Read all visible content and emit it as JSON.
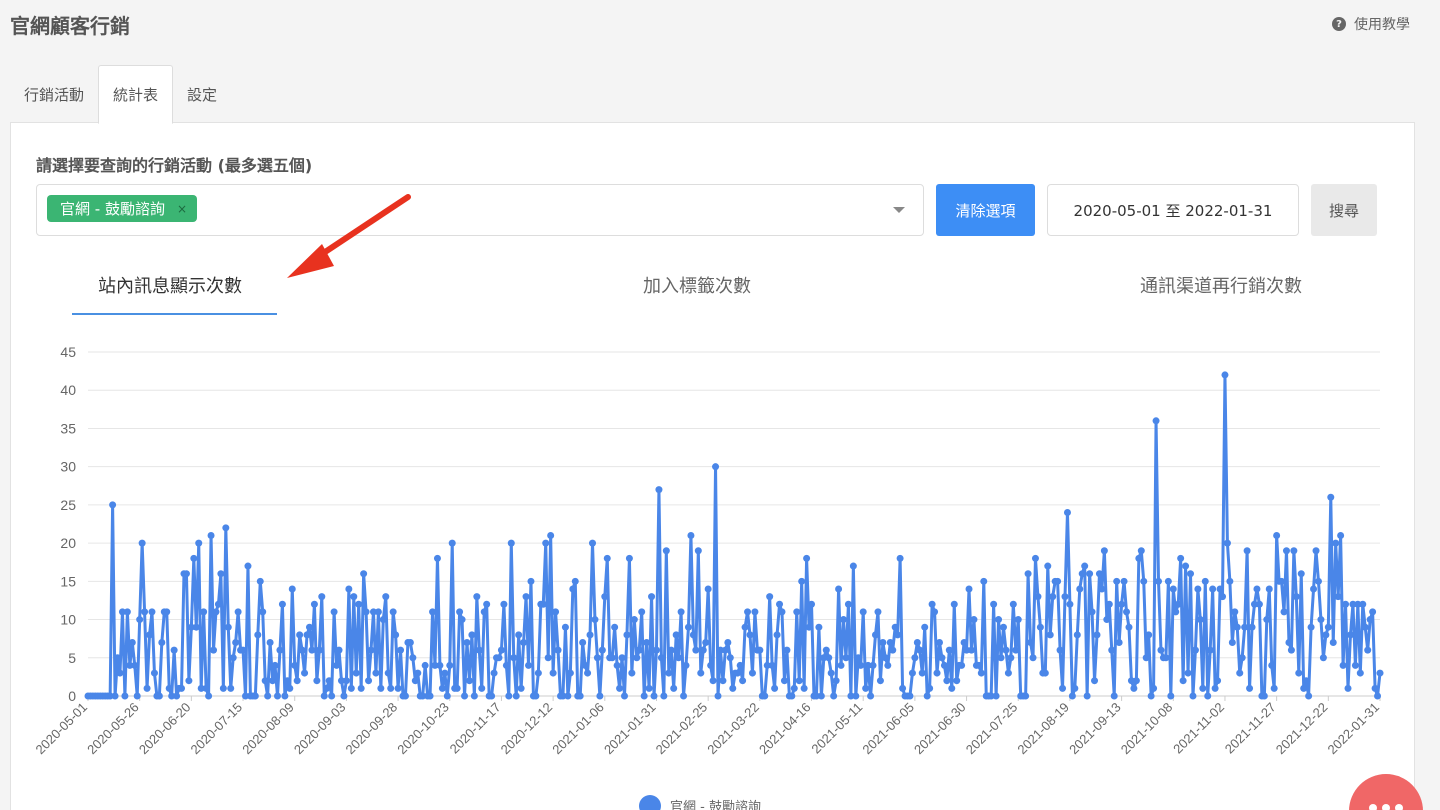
{
  "header": {
    "title": "官網顧客行銷",
    "help_label": "使用教學",
    "help_icon": "question-circle-icon"
  },
  "tabs": [
    {
      "label": "行銷活動"
    },
    {
      "label": "統計表"
    },
    {
      "label": "設定"
    }
  ],
  "filter": {
    "label": "請選擇要查詢的行銷活動 (最多選五個)",
    "selected_chip": "官網 - 鼓勵諮詢",
    "chip_remove": "×",
    "clear_button": "清除選項",
    "date_range": "2020-05-01 至 2022-01-31",
    "search_button": "搜尋"
  },
  "chart_tabs": [
    {
      "label": "站內訊息顯示次數"
    },
    {
      "label": "加入標籤次數"
    },
    {
      "label": "通訊渠道再行銷次數"
    }
  ],
  "colors": {
    "line": "#4a86e8",
    "clear_button": "#3d8ef5",
    "chip": "#3bb573",
    "arrow": "#e8321f",
    "fab": "#f06767"
  },
  "chart_data": {
    "type": "line",
    "series": [
      {
        "name": "官網 - 鼓勵諮詢",
        "values": [
          0,
          0,
          0,
          0,
          0,
          0,
          0,
          0,
          0,
          0,
          25,
          0,
          5,
          3,
          11,
          0,
          11,
          4,
          7,
          4,
          0,
          10,
          20,
          11,
          1,
          8,
          11,
          3,
          0,
          0,
          7,
          11,
          11,
          1,
          0,
          6,
          0,
          1,
          1,
          16,
          16,
          2,
          9,
          18,
          9,
          20,
          1,
          11,
          1,
          0,
          21,
          6,
          11,
          12,
          16,
          1,
          22,
          9,
          1,
          5,
          7,
          11,
          6,
          6,
          0,
          17,
          0,
          0,
          0,
          8,
          15,
          11,
          2,
          0,
          7,
          2,
          4,
          0,
          6,
          12,
          0,
          2,
          1,
          14,
          4,
          2,
          8,
          6,
          3,
          8,
          9,
          6,
          12,
          2,
          6,
          13,
          0,
          1,
          2,
          0,
          11,
          4,
          6,
          2,
          0,
          2,
          14,
          1,
          13,
          3,
          12,
          1,
          16,
          11,
          2,
          6,
          11,
          3,
          11,
          1,
          10,
          13,
          3,
          1,
          11,
          8,
          1,
          6,
          0,
          0,
          7,
          7,
          5,
          2,
          3,
          0,
          0,
          4,
          0,
          0,
          11,
          4,
          18,
          4,
          1,
          3,
          0,
          4,
          20,
          1,
          1,
          11,
          10,
          0,
          7,
          2,
          8,
          0,
          13,
          6,
          1,
          11,
          12,
          0,
          0,
          3,
          5,
          5,
          6,
          12,
          4,
          0,
          20,
          5,
          0,
          8,
          1,
          7,
          13,
          4,
          15,
          0,
          0,
          3,
          12,
          12,
          20,
          5,
          21,
          3,
          11,
          6,
          0,
          0,
          9,
          0,
          3,
          14,
          15,
          0,
          0,
          7,
          4,
          3,
          8,
          20,
          10,
          5,
          0,
          6,
          13,
          18,
          5,
          5,
          9,
          4,
          1,
          5,
          0,
          8,
          18,
          3,
          10,
          5,
          6,
          11,
          0,
          7,
          1,
          13,
          0,
          6,
          27,
          5,
          0,
          19,
          3,
          6,
          1,
          8,
          5,
          11,
          0,
          4,
          9,
          21,
          8,
          6,
          19,
          3,
          6,
          7,
          14,
          4,
          2,
          30,
          0,
          6,
          2,
          6,
          7,
          5,
          1,
          3,
          3,
          4,
          2,
          9,
          11,
          8,
          3,
          11,
          6,
          6,
          0,
          0,
          4,
          13,
          4,
          1,
          8,
          12,
          11,
          2,
          6,
          0,
          0,
          1,
          11,
          2,
          15,
          1,
          18,
          9,
          12,
          0,
          0,
          9,
          0,
          5,
          6,
          5,
          3,
          0,
          2,
          14,
          4,
          10,
          5,
          12,
          0,
          17,
          0,
          5,
          4,
          11,
          1,
          4,
          0,
          4,
          8,
          11,
          2,
          7,
          5,
          4,
          7,
          6,
          9,
          8,
          18,
          1,
          0,
          0,
          0,
          3,
          5,
          7,
          6,
          3,
          9,
          0,
          1,
          12,
          11,
          3,
          7,
          5,
          4,
          2,
          6,
          1,
          12,
          2,
          4,
          4,
          7,
          6,
          14,
          6,
          10,
          4,
          4,
          3,
          15,
          0,
          0,
          0,
          12,
          0,
          10,
          5,
          9,
          6,
          3,
          5,
          12,
          6,
          10,
          0,
          0,
          0,
          16,
          7,
          5,
          18,
          13,
          9,
          3,
          3,
          17,
          8,
          13,
          15,
          15,
          6,
          1,
          13,
          24,
          12,
          0,
          1,
          8,
          14,
          16,
          17,
          0,
          16,
          11,
          2,
          8,
          16,
          14,
          19,
          10,
          12,
          6,
          0,
          15,
          7,
          12,
          15,
          11,
          9,
          2,
          1,
          2,
          18,
          19,
          15,
          5,
          8,
          0,
          1,
          36,
          15,
          6,
          5,
          5,
          15,
          0,
          14,
          11,
          12,
          18,
          2,
          17,
          3,
          16,
          0,
          6,
          14,
          10,
          1,
          15,
          0,
          6,
          14,
          1,
          2,
          14,
          13,
          42,
          20,
          15,
          7,
          11,
          9,
          3,
          5,
          9,
          19,
          1,
          9,
          12,
          14,
          12,
          0,
          0,
          10,
          14,
          4,
          1,
          21,
          15,
          15,
          11,
          19,
          7,
          6,
          19,
          13,
          3,
          16,
          1,
          2,
          0,
          9,
          14,
          19,
          15,
          10,
          5,
          8,
          9,
          26,
          7,
          20,
          13,
          21,
          4,
          12,
          1,
          8,
          12,
          4,
          12,
          3,
          12,
          9,
          6,
          10,
          11,
          1,
          0,
          3
        ]
      }
    ],
    "x_ticks": [
      "2020-05-01",
      "2020-05-26",
      "2020-06-20",
      "2020-07-15",
      "2020-08-09",
      "2020-09-03",
      "2020-09-28",
      "2020-10-23",
      "2020-11-17",
      "2020-12-12",
      "2021-01-06",
      "2021-01-31",
      "2021-02-25",
      "2021-03-22",
      "2021-04-16",
      "2021-05-11",
      "2021-06-05",
      "2021-06-30",
      "2021-07-25",
      "2021-08-19",
      "2021-09-13",
      "2021-10-08",
      "2021-11-02",
      "2021-11-27",
      "2021-12-22",
      "2022-01-31"
    ],
    "y_ticks": [
      0,
      5,
      10,
      15,
      20,
      25,
      30,
      35,
      40,
      45
    ],
    "ylim": [
      0,
      45
    ],
    "grid": true,
    "legend": "bottom"
  }
}
